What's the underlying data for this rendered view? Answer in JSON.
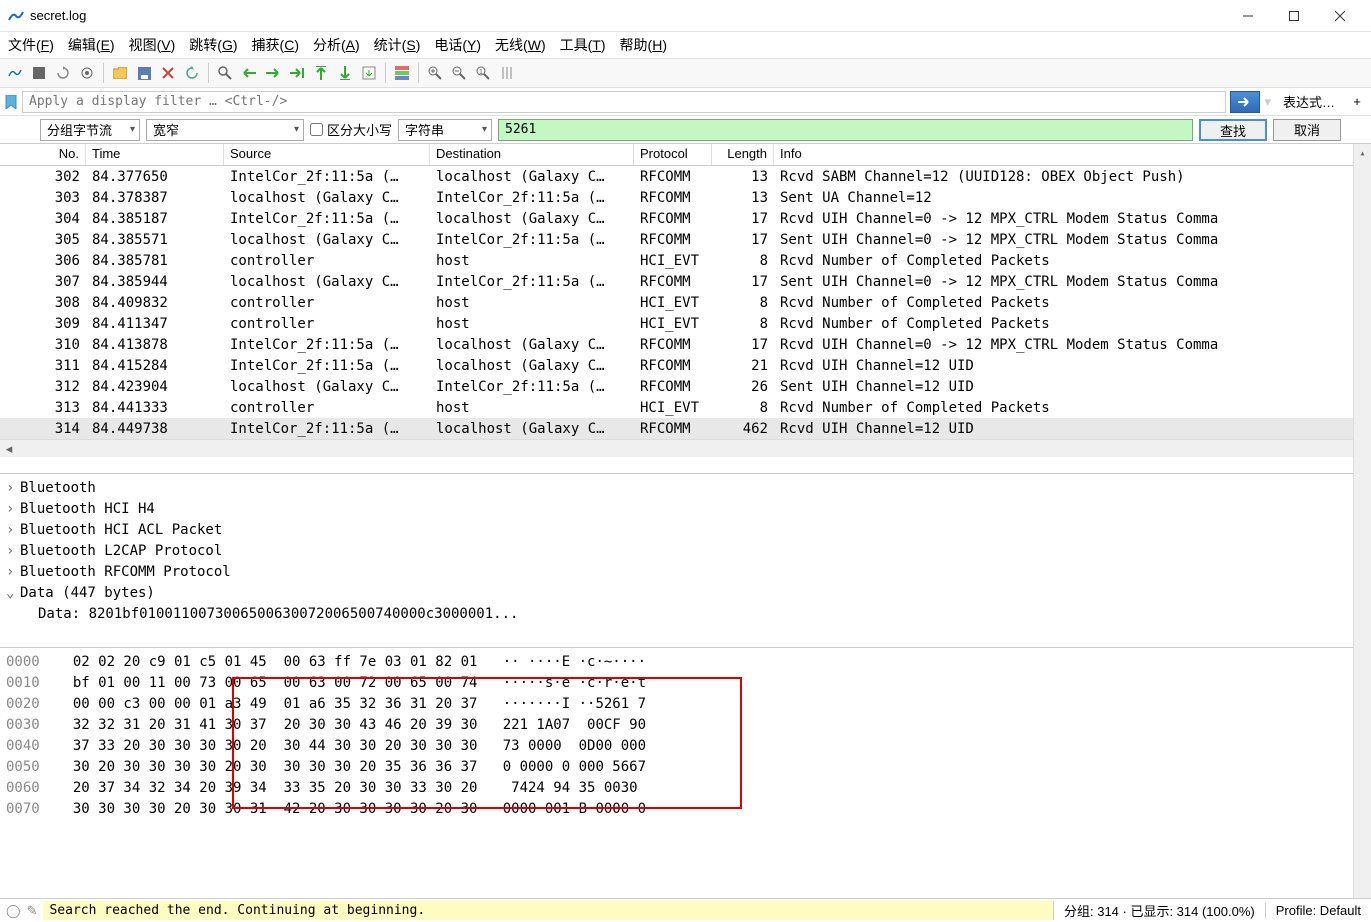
{
  "window": {
    "title": "secret.log"
  },
  "menu": {
    "file": "文件(F)",
    "edit": "编辑(E)",
    "view": "视图(V)",
    "go": "跳转(G)",
    "capture": "捕获(C)",
    "analyze": "分析(A)",
    "stats": "统计(S)",
    "telephony": "电话(Y)",
    "wireless": "无线(W)",
    "tools": "工具(T)",
    "help": "帮助(H)"
  },
  "filter": {
    "placeholder": "Apply a display filter … <Ctrl-/>",
    "expression": "表达式…"
  },
  "search": {
    "combo1": "分组字节流",
    "combo2": "宽窄",
    "case_label": "区分大小写",
    "combo3": "字符串",
    "value": "5261",
    "find": "查找",
    "cancel": "取消"
  },
  "columns": {
    "no": "No.",
    "time": "Time",
    "src": "Source",
    "dst": "Destination",
    "proto": "Protocol",
    "len": "Length",
    "info": "Info"
  },
  "packets": [
    {
      "no": "302",
      "time": "84.377650",
      "src": "IntelCor_2f:11:5a (…",
      "dst": "localhost (Galaxy C…",
      "proto": "RFCOMM",
      "len": "13",
      "info": "Rcvd SABM Channel=12 (UUID128: OBEX Object Push)"
    },
    {
      "no": "303",
      "time": "84.378387",
      "src": "localhost (Galaxy C…",
      "dst": "IntelCor_2f:11:5a (…",
      "proto": "RFCOMM",
      "len": "13",
      "info": "Sent UA Channel=12"
    },
    {
      "no": "304",
      "time": "84.385187",
      "src": "IntelCor_2f:11:5a (…",
      "dst": "localhost (Galaxy C…",
      "proto": "RFCOMM",
      "len": "17",
      "info": "Rcvd UIH Channel=0 -> 12 MPX_CTRL Modem Status Comma"
    },
    {
      "no": "305",
      "time": "84.385571",
      "src": "localhost (Galaxy C…",
      "dst": "IntelCor_2f:11:5a (…",
      "proto": "RFCOMM",
      "len": "17",
      "info": "Sent UIH Channel=0 -> 12 MPX_CTRL Modem Status Comma"
    },
    {
      "no": "306",
      "time": "84.385781",
      "src": "controller",
      "dst": "host",
      "proto": "HCI_EVT",
      "len": "8",
      "info": "Rcvd Number of Completed Packets"
    },
    {
      "no": "307",
      "time": "84.385944",
      "src": "localhost (Galaxy C…",
      "dst": "IntelCor_2f:11:5a (…",
      "proto": "RFCOMM",
      "len": "17",
      "info": "Sent UIH Channel=0 -> 12 MPX_CTRL Modem Status Comma"
    },
    {
      "no": "308",
      "time": "84.409832",
      "src": "controller",
      "dst": "host",
      "proto": "HCI_EVT",
      "len": "8",
      "info": "Rcvd Number of Completed Packets"
    },
    {
      "no": "309",
      "time": "84.411347",
      "src": "controller",
      "dst": "host",
      "proto": "HCI_EVT",
      "len": "8",
      "info": "Rcvd Number of Completed Packets"
    },
    {
      "no": "310",
      "time": "84.413878",
      "src": "IntelCor_2f:11:5a (…",
      "dst": "localhost (Galaxy C…",
      "proto": "RFCOMM",
      "len": "17",
      "info": "Rcvd UIH Channel=0 -> 12 MPX_CTRL Modem Status Comma"
    },
    {
      "no": "311",
      "time": "84.415284",
      "src": "IntelCor_2f:11:5a (…",
      "dst": "localhost (Galaxy C…",
      "proto": "RFCOMM",
      "len": "21",
      "info": "Rcvd UIH Channel=12 UID"
    },
    {
      "no": "312",
      "time": "84.423904",
      "src": "localhost (Galaxy C…",
      "dst": "IntelCor_2f:11:5a (…",
      "proto": "RFCOMM",
      "len": "26",
      "info": "Sent UIH Channel=12 UID"
    },
    {
      "no": "313",
      "time": "84.441333",
      "src": "controller",
      "dst": "host",
      "proto": "HCI_EVT",
      "len": "8",
      "info": "Rcvd Number of Completed Packets"
    },
    {
      "no": "314",
      "time": "84.449738",
      "src": "IntelCor_2f:11:5a (…",
      "dst": "localhost (Galaxy C…",
      "proto": "RFCOMM",
      "len": "462",
      "info": "Rcvd UIH Channel=12 UID",
      "selected": true
    }
  ],
  "tree": [
    {
      "toggle": ">",
      "label": "Bluetooth"
    },
    {
      "toggle": ">",
      "label": "Bluetooth HCI H4"
    },
    {
      "toggle": ">",
      "label": "Bluetooth HCI ACL Packet"
    },
    {
      "toggle": ">",
      "label": "Bluetooth L2CAP Protocol"
    },
    {
      "toggle": ">",
      "label": "Bluetooth RFCOMM Protocol"
    },
    {
      "toggle": "v",
      "label": "Data (447 bytes)"
    },
    {
      "toggle": "",
      "label": "Data: 8201bf0100110073006500630072006500740000c3000001...",
      "indent": true
    }
  ],
  "hex": [
    {
      "off": "0000",
      "h": "02 02 20 c9 01 c5 01 45  00 63 ff 7e 03 01 82 01",
      "a": "·· ····E ·c·~····"
    },
    {
      "off": "0010",
      "h": "bf 01 00 11 00 73 00 65  00 63 00 72 00 65 00 74",
      "a": "·····s·e ·c·r·e·t"
    },
    {
      "off": "0020",
      "h": "00 00 c3 00 00 01 a3 49  01 a6 35 32 36 31 20 37",
      "a": "·······I ··5261 7"
    },
    {
      "off": "0030",
      "h": "32 32 31 20 31 41 30 37  20 30 30 43 46 20 39 30",
      "a": "221 1A07  00CF 90"
    },
    {
      "off": "0040",
      "h": "37 33 20 30 30 30 30 20  30 44 30 30 20 30 30 30",
      "a": "73 0000  0D00 000"
    },
    {
      "off": "0050",
      "h": "30 20 30 30 30 30 20 30  30 30 30 20 35 36 36 37",
      "a": "0 0000 0 000 5667"
    },
    {
      "off": "0060",
      "h": "20 37 34 32 34 20 39 34  33 35 20 30 30 33 30 20",
      "a": " 7424 94 35 0030 "
    },
    {
      "off": "0070",
      "h": "30 30 30 30 20 30 30 31  42 20 30 30 30 30 20 30",
      "a": "0000 001 B 0000 0"
    }
  ],
  "status": {
    "message": "Search reached the end. Continuing at beginning.",
    "packets": "分组: 314 · 已显示: 314 (100.0%)",
    "profile": "Profile: Default"
  }
}
